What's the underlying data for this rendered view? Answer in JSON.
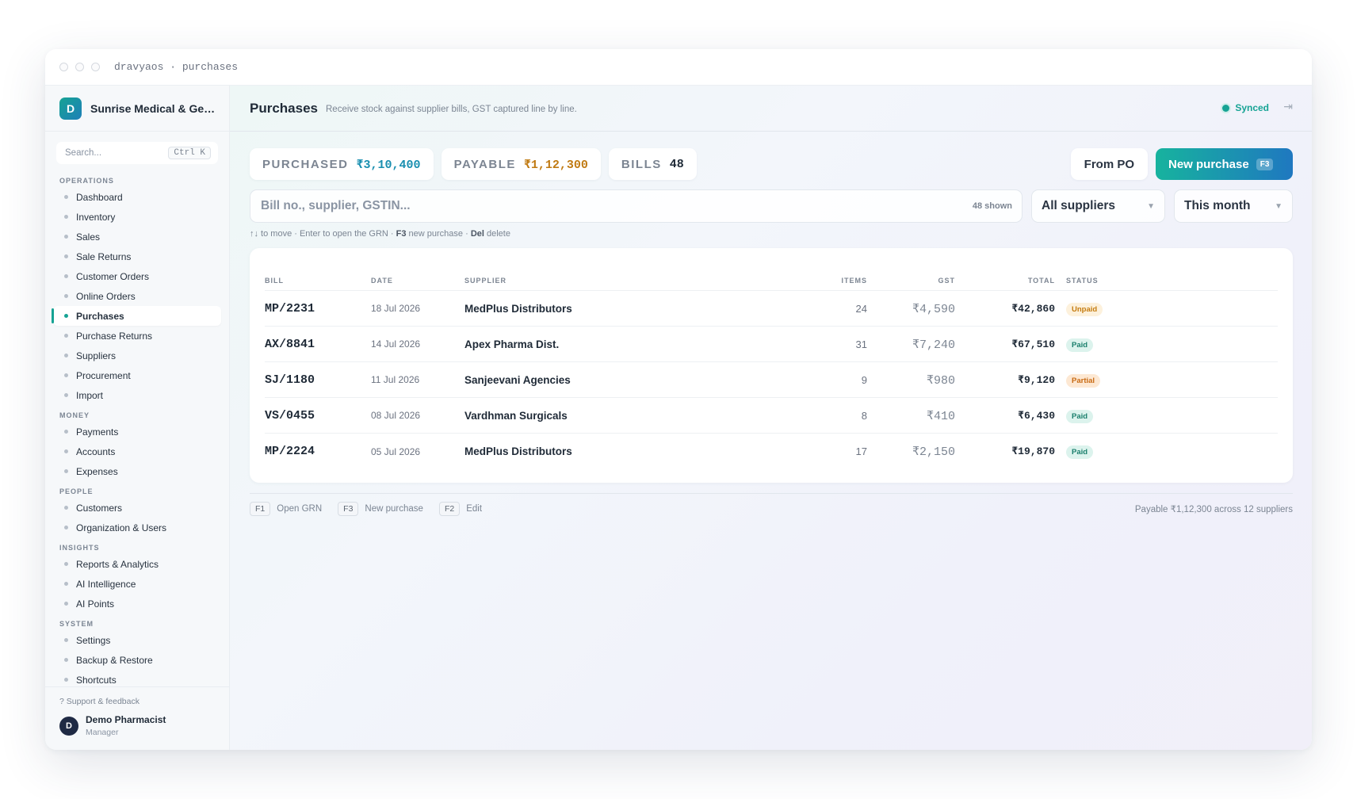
{
  "window": {
    "title": "dravyaos · purchases"
  },
  "sidebar": {
    "brand_initial": "D",
    "brand_name": "Sunrise Medical & General Store",
    "search_placeholder": "Search...",
    "search_shortcut": "Ctrl K",
    "sections": [
      {
        "title": "OPERATIONS",
        "items": [
          "Dashboard",
          "Inventory",
          "Sales",
          "Sale Returns",
          "Customer Orders",
          "Online Orders",
          "Purchases",
          "Purchase Returns",
          "Suppliers",
          "Procurement",
          "Import"
        ]
      },
      {
        "title": "MONEY",
        "items": [
          "Payments",
          "Accounts",
          "Expenses"
        ]
      },
      {
        "title": "PEOPLE",
        "items": [
          "Customers",
          "Organization & Users"
        ]
      },
      {
        "title": "INSIGHTS",
        "items": [
          "Reports & Analytics",
          "AI Intelligence",
          "AI Points"
        ]
      },
      {
        "title": "SYSTEM",
        "items": [
          "Settings",
          "Backup & Restore",
          "Shortcuts"
        ]
      }
    ],
    "active_item": "Purchases",
    "support": "? Support & feedback",
    "user": {
      "initial": "D",
      "name": "Demo Pharmacist",
      "role": "Manager"
    }
  },
  "header": {
    "title": "Purchases",
    "subtitle": "Receive stock against supplier bills, GST captured line by line.",
    "sync_status": "Synced"
  },
  "stats": [
    {
      "label": "PURCHASED",
      "value": "₹3,10,400",
      "color": "#1a8fb0"
    },
    {
      "label": "PAYABLE",
      "value": "₹1,12,300",
      "color": "#c07a12"
    },
    {
      "label": "BILLS",
      "value": "48",
      "color": "#1f2a37"
    }
  ],
  "actions": {
    "from_po": "From PO",
    "new_purchase": "New purchase",
    "new_purchase_key": "F3"
  },
  "filters": {
    "search_placeholder": "Bill no., supplier, GSTIN...",
    "shown_count": "48 shown",
    "supplier": "All suppliers",
    "period": "This month"
  },
  "hint": {
    "prefix": "↑↓ to move · Enter to open the GRN · ",
    "k1": "F3",
    "mid": " new purchase · ",
    "k2": "Del",
    "suffix": " delete"
  },
  "table": {
    "columns": [
      "BILL",
      "DATE",
      "SUPPLIER",
      "ITEMS",
      "GST",
      "TOTAL",
      "STATUS"
    ],
    "rows": [
      {
        "bill": "MP/2231",
        "date": "18 Jul 2026",
        "supplier": "MedPlus Distributors",
        "items": "24",
        "gst": "₹4,590",
        "total": "₹42,860",
        "status": "Unpaid"
      },
      {
        "bill": "AX/8841",
        "date": "14 Jul 2026",
        "supplier": "Apex Pharma Dist.",
        "items": "31",
        "gst": "₹7,240",
        "total": "₹67,510",
        "status": "Paid"
      },
      {
        "bill": "SJ/1180",
        "date": "11 Jul 2026",
        "supplier": "Sanjeevani Agencies",
        "items": "9",
        "gst": "₹980",
        "total": "₹9,120",
        "status": "Partial"
      },
      {
        "bill": "VS/0455",
        "date": "08 Jul 2026",
        "supplier": "Vardhman Surgicals",
        "items": "8",
        "gst": "₹410",
        "total": "₹6,430",
        "status": "Paid"
      },
      {
        "bill": "MP/2224",
        "date": "05 Jul 2026",
        "supplier": "MedPlus Distributors",
        "items": "17",
        "gst": "₹2,150",
        "total": "₹19,870",
        "status": "Paid"
      }
    ]
  },
  "footer": {
    "shortcuts": [
      {
        "key": "F1",
        "label": "Open GRN"
      },
      {
        "key": "F3",
        "label": "New purchase"
      },
      {
        "key": "F2",
        "label": "Edit"
      }
    ],
    "note": "Payable ₹1,12,300 across 12 suppliers"
  }
}
